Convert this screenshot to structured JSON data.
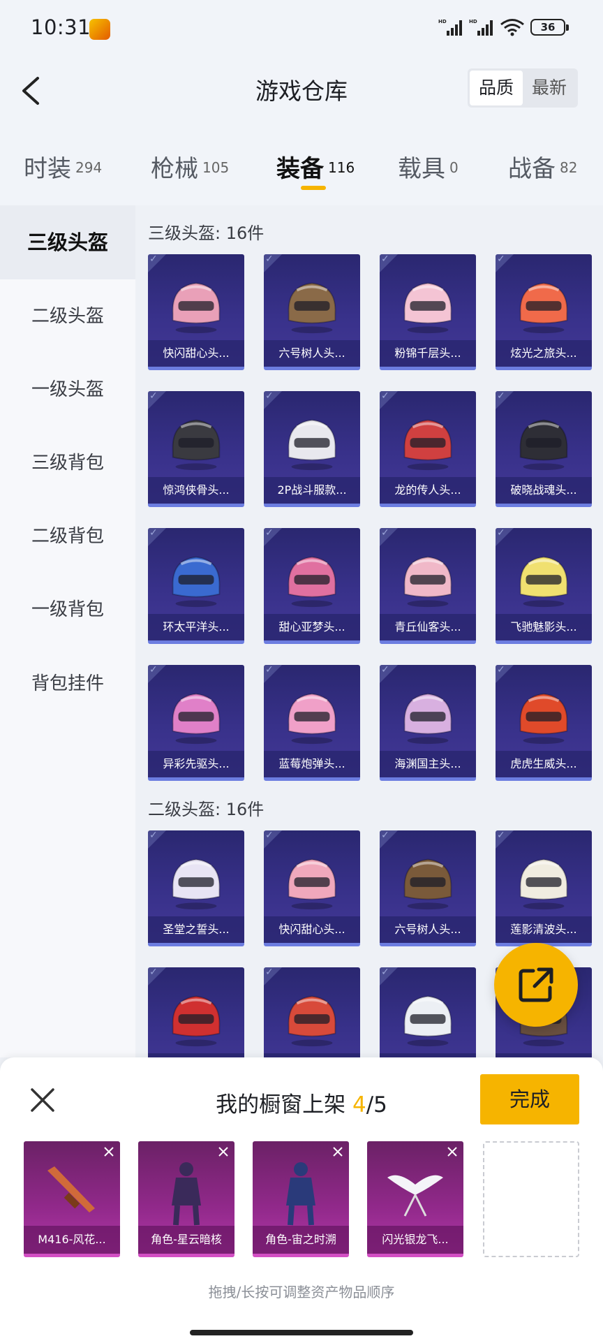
{
  "status_bar": {
    "time": "10:31",
    "battery": "36",
    "app_icon": "game-app-icon"
  },
  "header": {
    "title": "游戏仓库",
    "back_icon": "back-arrow-icon",
    "sort_options": [
      {
        "label": "品质",
        "active": true
      },
      {
        "label": "最新",
        "active": false
      }
    ]
  },
  "tabs": [
    {
      "label": "时装",
      "count": "294"
    },
    {
      "label": "枪械",
      "count": "105"
    },
    {
      "label": "装备",
      "count": "116",
      "active": true
    },
    {
      "label": "载具",
      "count": "0"
    },
    {
      "label": "战备",
      "count": "82"
    }
  ],
  "sidebar": {
    "items": [
      {
        "label": "三级头盔",
        "active": true
      },
      {
        "label": "二级头盔"
      },
      {
        "label": "一级头盔"
      },
      {
        "label": "三级背包"
      },
      {
        "label": "二级背包"
      },
      {
        "label": "一级背包"
      },
      {
        "label": "背包挂件"
      }
    ]
  },
  "sections": [
    {
      "title": "三级头盔: 16件",
      "items": [
        {
          "label": "快闪甜心头...",
          "color": "#e9a0b8"
        },
        {
          "label": "六号树人头...",
          "color": "#8a6a48"
        },
        {
          "label": "粉锦千层头...",
          "color": "#f4c4d4"
        },
        {
          "label": "炫光之旅头...",
          "color": "#f06a4a"
        },
        {
          "label": "惊鸿侠骨头...",
          "color": "#3a3a40"
        },
        {
          "label": "2P战斗服款...",
          "color": "#e8e8ee"
        },
        {
          "label": "龙的传人头...",
          "color": "#d04040"
        },
        {
          "label": "破晓战魂头...",
          "color": "#2e2e36"
        },
        {
          "label": "环太平洋头...",
          "color": "#3a6ad0"
        },
        {
          "label": "甜心亚梦头...",
          "color": "#e070a0"
        },
        {
          "label": "青丘仙客头...",
          "color": "#f0b8c8"
        },
        {
          "label": "飞驰魅影头...",
          "color": "#f0e070"
        },
        {
          "label": "异彩先驱头...",
          "color": "#e080c8"
        },
        {
          "label": "蓝莓炮弹头...",
          "color": "#f0a0c8"
        },
        {
          "label": "海渊国主头...",
          "color": "#d8b0e0"
        },
        {
          "label": "虎虎生威头...",
          "color": "#e04a2a"
        }
      ]
    },
    {
      "title": "二级头盔: 16件",
      "items": [
        {
          "label": "圣堂之誓头...",
          "color": "#e8e4f4"
        },
        {
          "label": "快闪甜心头...",
          "color": "#f0a8bc"
        },
        {
          "label": "六号树人头...",
          "color": "#7a5a3a"
        },
        {
          "label": "莲影清波头...",
          "color": "#f0ece0"
        },
        {
          "label": "",
          "color": "#d03030"
        },
        {
          "label": "",
          "color": "#d84a3a"
        },
        {
          "label": "",
          "color": "#eceff4"
        },
        {
          "label": "",
          "color": "#6a5040"
        }
      ]
    }
  ],
  "fab": {
    "icon": "share-export-icon"
  },
  "showcase": {
    "title_prefix": "我的橱窗上架 ",
    "count": "4",
    "total": "/5",
    "done_label": "完成",
    "close_icon": "close-icon",
    "items": [
      {
        "label": "M416-风花...",
        "color": "#d06a3a"
      },
      {
        "label": "角色-星云暗核",
        "color": "#3a2a5a"
      },
      {
        "label": "角色-宙之时溯",
        "color": "#2a3a7a"
      },
      {
        "label": "闪光银龙飞...",
        "color": "#f4f4f8"
      }
    ],
    "hint": "拖拽/长按可调整资产物品顺序"
  }
}
